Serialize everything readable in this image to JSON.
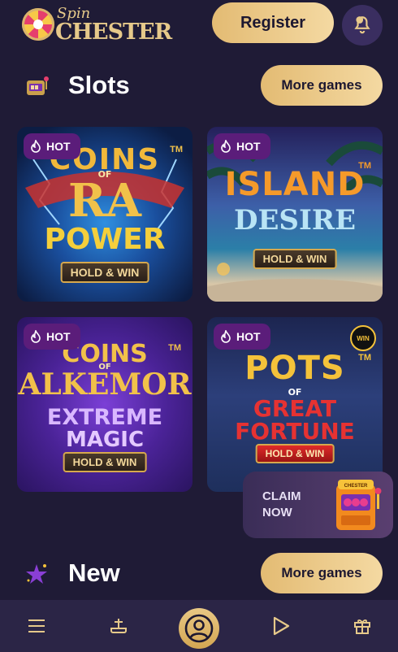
{
  "header": {
    "logo_top": "Spin",
    "logo_main": "CHESTER",
    "register_label": "Register"
  },
  "slots": {
    "title": "Slots",
    "more_label": "More games",
    "games": [
      {
        "badge": "HOT",
        "title_lines": [
          "COINS",
          "OF",
          "RA",
          "POWER"
        ],
        "tag": "HOLD & WIN",
        "tm": "TM"
      },
      {
        "badge": "HOT",
        "title_lines": [
          "ISLAND",
          "DESIRE"
        ],
        "tag": "HOLD & WIN",
        "tm": "TM"
      },
      {
        "badge": "HOT",
        "title_lines": [
          "COINS",
          "OF",
          "ALKEMOR",
          "EXTREME",
          "MAGIC"
        ],
        "tag": "HOLD & WIN",
        "tm": "TM"
      },
      {
        "badge": "HOT",
        "title_lines": [
          "POTS",
          "OF",
          "GREAT",
          "FORTUNE"
        ],
        "tag": "HOLD & WIN",
        "tm": "TM",
        "win_badge": "WIN"
      }
    ]
  },
  "claim": {
    "label": "CLAIM NOW",
    "line1": "CLAIM",
    "line2": "NOW",
    "machine_label": "CHESTER"
  },
  "new_section": {
    "title": "New",
    "more_label": "More games"
  },
  "nav": {
    "items": [
      "menu-icon",
      "joystick-icon",
      "profile-icon",
      "play-icon",
      "gift-icon"
    ]
  },
  "colors": {
    "background": "#1f1b36",
    "gold": "#e3bb73",
    "hot_badge": "#5b1d7a",
    "nav": "#2b2546"
  }
}
